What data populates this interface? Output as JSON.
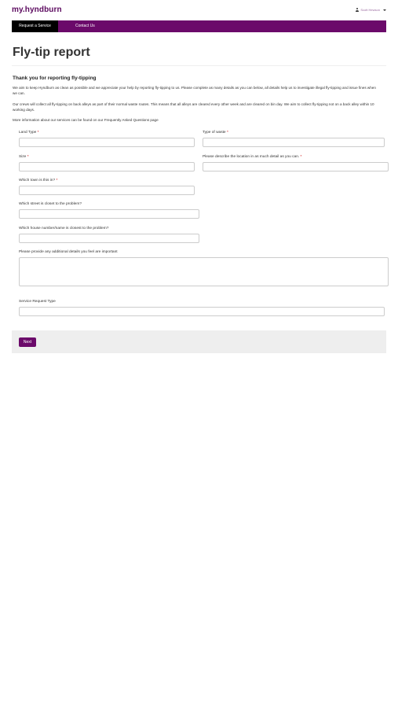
{
  "header": {
    "brand": "my.hyndburn",
    "user_name": "Scott Hewson"
  },
  "nav": {
    "items": [
      {
        "label": "Request a Service"
      },
      {
        "label": "Contact Us"
      }
    ]
  },
  "page": {
    "title": "Fly-tip report",
    "intro_heading": "Thank you for reporting fly-tipping",
    "paragraphs": [
      "We aim to keep Hyndburn as clean as possible and we appreciate your help by reporting fly-tipping to us.  Please complete as many details as you can below, all details help us to investigate illegal fly-tipping and issue fines when we can.",
      "Our crews will collect all fly-tipping on back alleys as part of their normal waste routes.  This means that all alleys are cleared every other week and are cleared on bin day.  We aim to collect fly-tipping not on a back alley within 10 working days.",
      "More information about our services can be found on our Frequently Asked Questions page"
    ]
  },
  "form": {
    "land_type": {
      "label": "Land Type",
      "required_mark": "*",
      "value": ""
    },
    "type_of_waste": {
      "label": "Type of waste",
      "required_mark": "*",
      "value": ""
    },
    "size": {
      "label": "Size",
      "required_mark": "*",
      "value": ""
    },
    "location": {
      "label": "Please describe the location in as much detail as you can.",
      "required_mark": "*",
      "value": ""
    },
    "town": {
      "label": "Which town is this in?",
      "required_mark": "*",
      "value": ""
    },
    "street": {
      "label": "Which street is closet to the problem?",
      "value": ""
    },
    "house": {
      "label": "Which house number/name is closest to the problem?",
      "value": ""
    },
    "details": {
      "label": "Please provide any additional details you feel are important",
      "value": ""
    },
    "service_request_type": {
      "label": "Service Request Type",
      "value": ""
    },
    "next_label": "Next"
  },
  "colors": {
    "brand_purple": "#6b0a6a",
    "active_nav": "#000000",
    "panel_grey": "#eeeeee",
    "required_red": "#cc0000"
  }
}
